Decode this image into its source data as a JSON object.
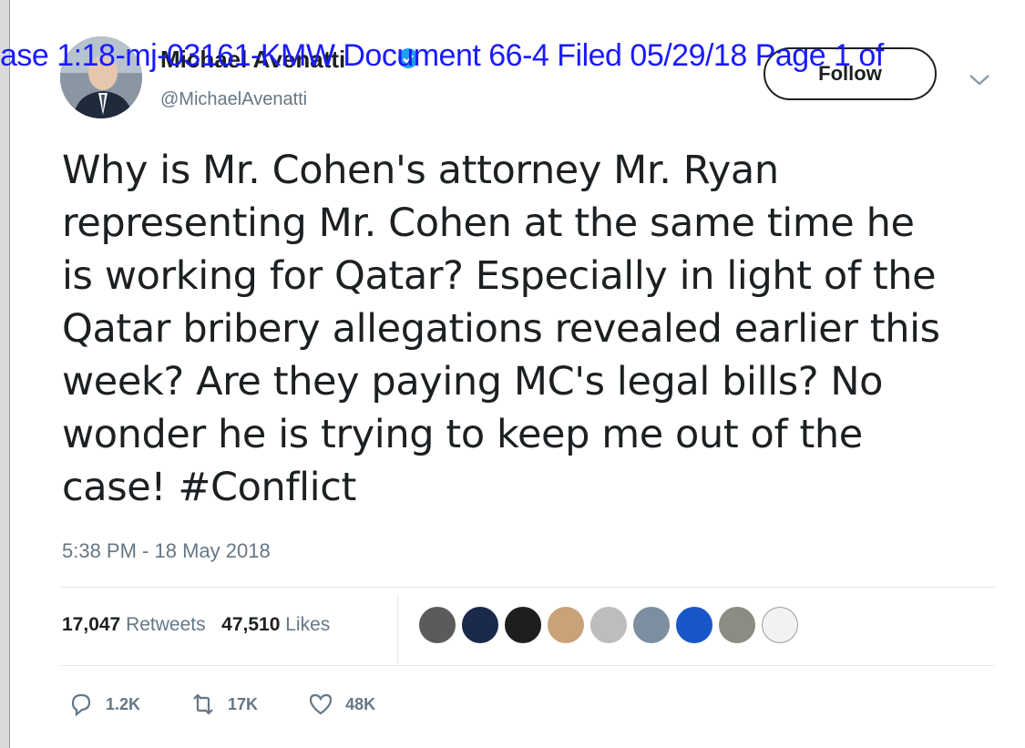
{
  "document_stamp": "ase 1:18-mj-03161-KMW   Document 66-4    Filed 05/29/18    Page 1 of",
  "tweet": {
    "display_name": "Michael Avenatti",
    "handle": "@MichaelAvenatti",
    "follow_label": "Follow",
    "text_lines": [
      "Why is Mr. Cohen's attorney Mr. Ryan",
      "representing Mr. Cohen at the same time he",
      "is working for Qatar? Especially in light of the",
      "Qatar bribery allegations revealed earlier this",
      "week? Are they paying MC's legal bills? No",
      "wonder he is trying to keep me out of the",
      "case!  #Conflict"
    ],
    "timestamp": "5:38 PM - 18 May 2018",
    "retweets_count": "17,047",
    "retweets_label": "Retweets",
    "likes_count": "47,510",
    "likes_label": "Likes",
    "liker_colors": [
      "#5b5b5b",
      "#1b2a4a",
      "#1e1e1e",
      "#c9a27a",
      "#bdbdbd",
      "#7d8ea0",
      "#1856c8",
      "#8c8c82",
      "#f2f2f2"
    ],
    "actions": {
      "reply_count": "1.2K",
      "retweet_count": "17K",
      "like_count": "48K"
    }
  },
  "icons": {
    "verified": "verified-badge-icon",
    "caret": "chevron-down-icon",
    "reply": "reply-icon",
    "retweet": "retweet-icon",
    "like": "heart-icon"
  }
}
